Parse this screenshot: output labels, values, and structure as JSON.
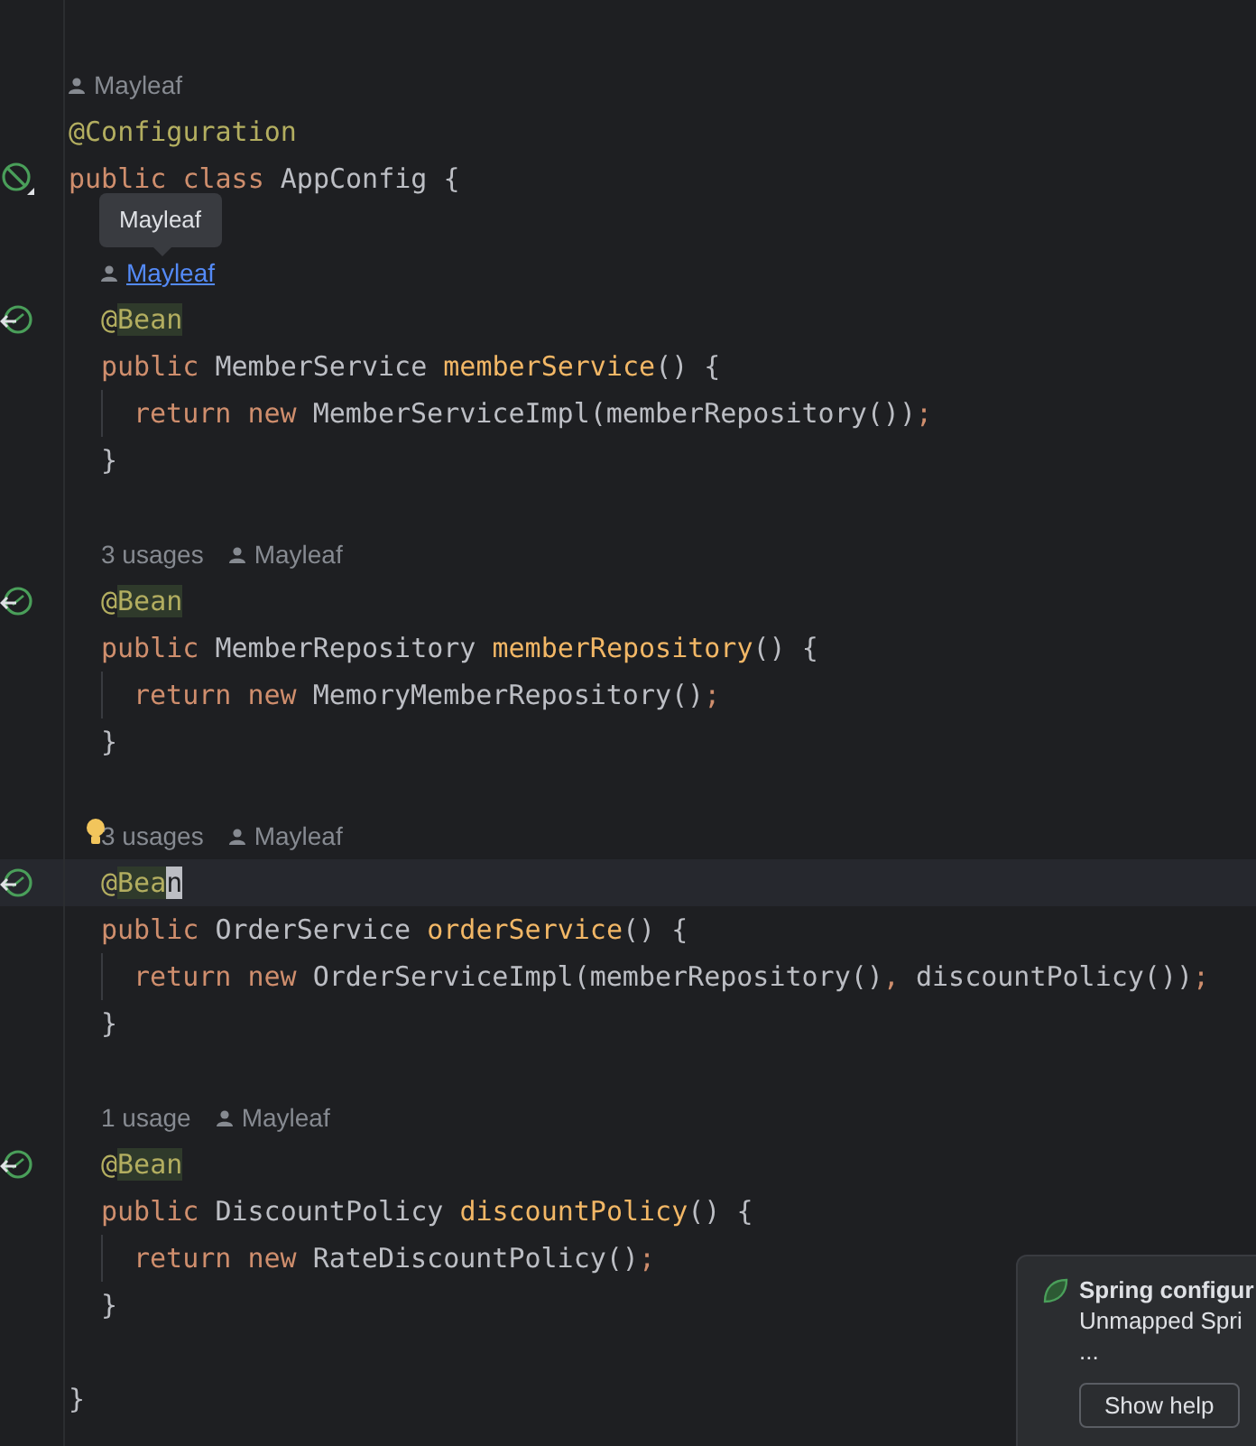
{
  "lines": [
    {
      "kind": "inlay",
      "indented": false,
      "hints": [
        {
          "kind": "author",
          "text": "Mayleaf"
        }
      ]
    },
    {
      "kind": "code",
      "tokens": [
        {
          "kind": "annotation",
          "text": "@Configuration"
        }
      ]
    },
    {
      "kind": "code",
      "gutter": {
        "kind": "config"
      },
      "tokens": [
        {
          "kind": "keyword",
          "text": "public class "
        },
        {
          "kind": "plain",
          "text": "AppConfig {"
        }
      ]
    },
    {
      "kind": "blank"
    },
    {
      "kind": "inlay",
      "indented": true,
      "hints": [
        {
          "kind": "link",
          "text": "Mayleaf"
        }
      ]
    },
    {
      "kind": "code",
      "indented": true,
      "gutter": {
        "kind": "bean"
      },
      "tokens": [
        {
          "kind": "annotation",
          "text": "@"
        },
        {
          "kind": "annotation",
          "text": "Bean",
          "marked": true
        }
      ]
    },
    {
      "kind": "code",
      "indented": true,
      "tokens": [
        {
          "kind": "keyword",
          "text": "public "
        },
        {
          "kind": "plain",
          "text": "MemberService "
        },
        {
          "kind": "method",
          "text": "memberService"
        },
        {
          "kind": "plain",
          "text": "() {"
        }
      ]
    },
    {
      "kind": "code",
      "indented": true,
      "guide": true,
      "tokens": [
        {
          "kind": "keyword",
          "text": "return new "
        },
        {
          "kind": "plain",
          "text": "MemberServiceImpl(memberRepository())"
        },
        {
          "kind": "keyword",
          "text": ";"
        }
      ]
    },
    {
      "kind": "code",
      "indented": true,
      "tokens": [
        {
          "kind": "plain",
          "text": "}"
        }
      ]
    },
    {
      "kind": "blank"
    },
    {
      "kind": "inlay",
      "indented": true,
      "hints": [
        {
          "kind": "usages",
          "text": "3 usages"
        },
        {
          "kind": "author",
          "text": "Mayleaf"
        }
      ]
    },
    {
      "kind": "code",
      "indented": true,
      "gutter": {
        "kind": "bean"
      },
      "tokens": [
        {
          "kind": "annotation",
          "text": "@"
        },
        {
          "kind": "annotation",
          "text": "Bean",
          "marked": true
        }
      ]
    },
    {
      "kind": "code",
      "indented": true,
      "tokens": [
        {
          "kind": "keyword",
          "text": "public "
        },
        {
          "kind": "plain",
          "text": "MemberRepository "
        },
        {
          "kind": "method",
          "text": "memberRepository"
        },
        {
          "kind": "plain",
          "text": "() {"
        }
      ]
    },
    {
      "kind": "code",
      "indented": true,
      "guide": true,
      "tokens": [
        {
          "kind": "keyword",
          "text": "return new "
        },
        {
          "kind": "plain",
          "text": "MemoryMemberRepository()"
        },
        {
          "kind": "keyword",
          "text": ";"
        }
      ]
    },
    {
      "kind": "code",
      "indented": true,
      "tokens": [
        {
          "kind": "plain",
          "text": "}"
        }
      ]
    },
    {
      "kind": "blank"
    },
    {
      "kind": "inlay",
      "indented": true,
      "bulb": true,
      "hints": [
        {
          "kind": "usages",
          "text": "3 usages"
        },
        {
          "kind": "author",
          "text": "Mayleaf"
        }
      ]
    },
    {
      "kind": "code",
      "indented": true,
      "gutter": {
        "kind": "bean"
      },
      "current": true,
      "tokens": [
        {
          "kind": "annotation",
          "text": "@"
        },
        {
          "kind": "annotation",
          "text": "Bea",
          "marked": true
        },
        {
          "kind": "annotation",
          "text": "n",
          "marked": true,
          "caret": true
        }
      ]
    },
    {
      "kind": "code",
      "indented": true,
      "tokens": [
        {
          "kind": "keyword",
          "text": "public "
        },
        {
          "kind": "plain",
          "text": "OrderService "
        },
        {
          "kind": "method",
          "text": "orderService"
        },
        {
          "kind": "plain",
          "text": "() {"
        }
      ]
    },
    {
      "kind": "code",
      "indented": true,
      "guide": true,
      "tokens": [
        {
          "kind": "keyword",
          "text": "return new "
        },
        {
          "kind": "plain",
          "text": "OrderServiceImpl(memberRepository()"
        },
        {
          "kind": "keyword",
          "text": ", "
        },
        {
          "kind": "plain",
          "text": "discountPolicy())"
        },
        {
          "kind": "keyword",
          "text": ";"
        }
      ]
    },
    {
      "kind": "code",
      "indented": true,
      "tokens": [
        {
          "kind": "plain",
          "text": "}"
        }
      ]
    },
    {
      "kind": "blank"
    },
    {
      "kind": "inlay",
      "indented": true,
      "hints": [
        {
          "kind": "usages",
          "text": "1 usage"
        },
        {
          "kind": "author",
          "text": "Mayleaf"
        }
      ]
    },
    {
      "kind": "code",
      "indented": true,
      "gutter": {
        "kind": "bean"
      },
      "tokens": [
        {
          "kind": "annotation",
          "text": "@"
        },
        {
          "kind": "annotation",
          "text": "Bean",
          "marked": true
        }
      ]
    },
    {
      "kind": "code",
      "indented": true,
      "tokens": [
        {
          "kind": "keyword",
          "text": "public "
        },
        {
          "kind": "plain",
          "text": "DiscountPolicy "
        },
        {
          "kind": "method",
          "text": "discountPolicy"
        },
        {
          "kind": "plain",
          "text": "() {"
        }
      ]
    },
    {
      "kind": "code",
      "indented": true,
      "guide": true,
      "tokens": [
        {
          "kind": "keyword",
          "text": "return new "
        },
        {
          "kind": "plain",
          "text": "RateDiscountPolicy()"
        },
        {
          "kind": "keyword",
          "text": ";"
        }
      ]
    },
    {
      "kind": "code",
      "indented": true,
      "tokens": [
        {
          "kind": "plain",
          "text": "}"
        }
      ]
    },
    {
      "kind": "blank"
    },
    {
      "kind": "code",
      "tokens": [
        {
          "kind": "plain",
          "text": "}"
        }
      ]
    }
  ],
  "tooltip": {
    "text": "Mayleaf"
  },
  "notification": {
    "title": "Spring configur",
    "message": "Unmapped Spri",
    "more": "...",
    "button": "Show help"
  }
}
